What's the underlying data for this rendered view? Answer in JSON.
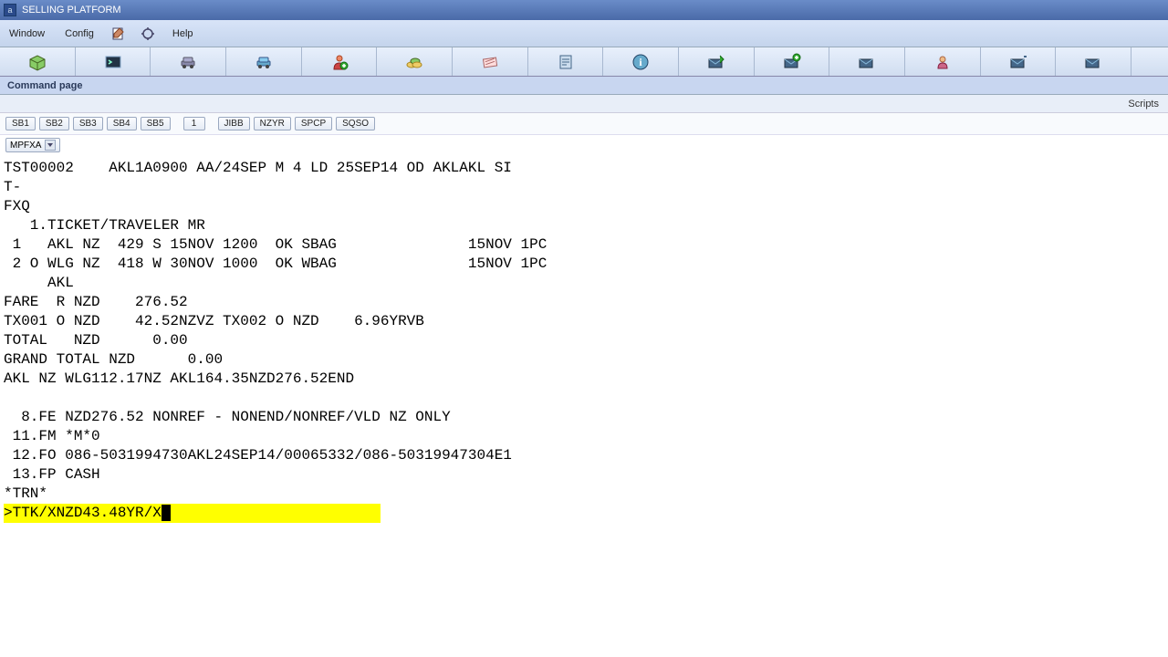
{
  "title": "SELLING PLATFORM",
  "menu": {
    "window": "Window",
    "config": "Config",
    "help": "Help"
  },
  "subheader": "Command page",
  "scripts_label": "Scripts",
  "quick_buttons": {
    "sb1": "SB1",
    "sb2": "SB2",
    "sb3": "SB3",
    "sb4": "SB4",
    "sb5": "SB5",
    "one": "1",
    "jibb": "JIBB",
    "nzyr": "NZYR",
    "spcp": "SPCP",
    "sqso": "SQSO"
  },
  "dropdown_value": "MPFXA",
  "terminal_lines": [
    "TST00002    AKL1A0900 AA/24SEP M 4 LD 25SEP14 OD AKLAKL SI",
    "T-",
    "FXQ",
    "   1.TICKET/TRAVELER MR",
    " 1   AKL NZ  429 S 15NOV 1200  OK SBAG               15NOV 1PC",
    " 2 O WLG NZ  418 W 30NOV 1000  OK WBAG               15NOV 1PC",
    "     AKL",
    "FARE  R NZD    276.52",
    "TX001 O NZD    42.52NZVZ TX002 O NZD    6.96YRVB",
    "TOTAL   NZD      0.00",
    "GRAND TOTAL NZD      0.00",
    "AKL NZ WLG112.17NZ AKL164.35NZD276.52END",
    "",
    "  8.FE NZD276.52 NONREF - NONEND/NONREF/VLD NZ ONLY",
    " 11.FM *M*0",
    " 12.FO 086-5031994730AKL24SEP14/00065332/086-50319947304E1",
    " 13.FP CASH",
    "*TRN*"
  ],
  "command_input": ">TTK/XNZD43.48YR/X"
}
